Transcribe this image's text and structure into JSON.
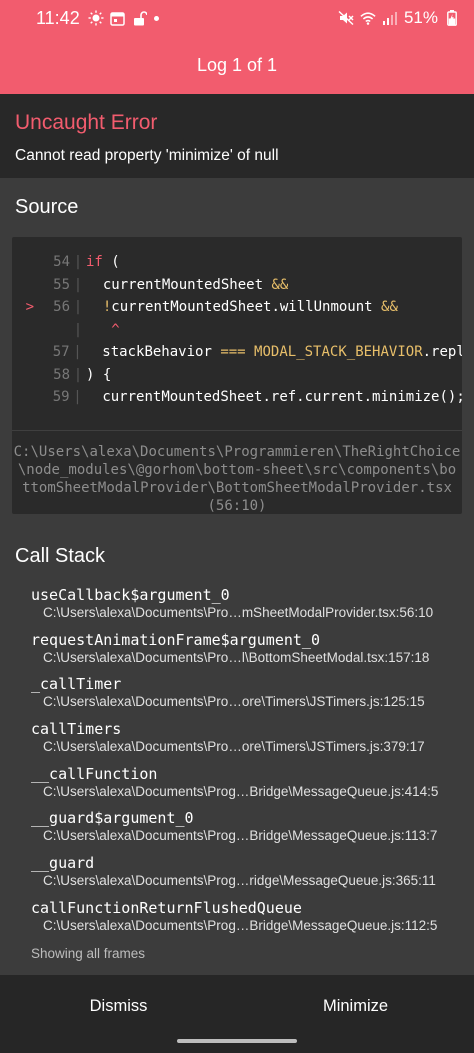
{
  "status_bar": {
    "time": "11:42",
    "battery": "51%",
    "left_icons": [
      "weather-sun-icon",
      "calendar-icon",
      "lock-open-icon",
      "notification-dot-icon"
    ],
    "right_icons": [
      "mute-icon",
      "wifi-icon",
      "signal-icon",
      "battery-icon"
    ]
  },
  "header": {
    "title": "Log 1 of 1"
  },
  "error": {
    "title": "Uncaught Error",
    "message": "Cannot read property 'minimize' of null"
  },
  "source": {
    "heading": "Source",
    "lines": [
      {
        "arrow": "",
        "num": "54",
        "code_html": "<span class='kw-pink'>if</span> ("
      },
      {
        "arrow": "",
        "num": "55",
        "code_html": "  currentMountedSheet <span class='kw-yel'>&amp;&amp;</span>"
      },
      {
        "arrow": ">",
        "num": "56",
        "code_html": "  <span class='kw-yel'>!</span>currentMountedSheet.willUnmount <span class='kw-yel'>&amp;&amp;</span>"
      },
      {
        "arrow": "",
        "num": "",
        "code_html": "   <span class='caret'>^</span>"
      },
      {
        "arrow": "",
        "num": "57",
        "code_html": "  stackBehavior <span class='kw-yel'>===</span> <span class='kw-yel'>MODAL_STACK_BEHAVIOR</span>.repl"
      },
      {
        "arrow": "",
        "num": "58",
        "code_html": ") {"
      },
      {
        "arrow": "",
        "num": "59",
        "code_html": "  currentMountedSheet.ref.current.minimize();"
      }
    ],
    "file_lines": [
      "C:\\Users\\alexa\\Documents\\Programmieren\\TheRightChoice",
      "\\node_modules\\@gorhom\\bottom-sheet\\src\\components\\bo",
      "ttomSheetModalProvider\\BottomSheetModalProvider.tsx",
      "(56:10)"
    ]
  },
  "call_stack": {
    "heading": "Call Stack",
    "frames": [
      {
        "name": "useCallback$argument_0",
        "path": "C:\\Users\\alexa\\Documents\\Pro…mSheetModalProvider.tsx:56:10"
      },
      {
        "name": "requestAnimationFrame$argument_0",
        "path": "C:\\Users\\alexa\\Documents\\Pro…l\\BottomSheetModal.tsx:157:18"
      },
      {
        "name": "_callTimer",
        "path": "C:\\Users\\alexa\\Documents\\Pro…ore\\Timers\\JSTimers.js:125:15"
      },
      {
        "name": "callTimers",
        "path": "C:\\Users\\alexa\\Documents\\Pro…ore\\Timers\\JSTimers.js:379:17"
      },
      {
        "name": "__callFunction",
        "path": "C:\\Users\\alexa\\Documents\\Prog…Bridge\\MessageQueue.js:414:5"
      },
      {
        "name": "__guard$argument_0",
        "path": "C:\\Users\\alexa\\Documents\\Prog…Bridge\\MessageQueue.js:113:7"
      },
      {
        "name": "__guard",
        "path": "C:\\Users\\alexa\\Documents\\Prog…ridge\\MessageQueue.js:365:11"
      },
      {
        "name": "callFunctionReturnFlushedQueue",
        "path": "C:\\Users\\alexa\\Documents\\Prog…Bridge\\MessageQueue.js:112:5"
      }
    ],
    "footer": "Showing all frames"
  },
  "actions": {
    "dismiss": "Dismiss",
    "minimize": "Minimize"
  },
  "colors": {
    "accent": "#f25c6e",
    "background": "#3c3c3c",
    "panel": "#282828",
    "code_keyword": "#e8bf6a"
  }
}
